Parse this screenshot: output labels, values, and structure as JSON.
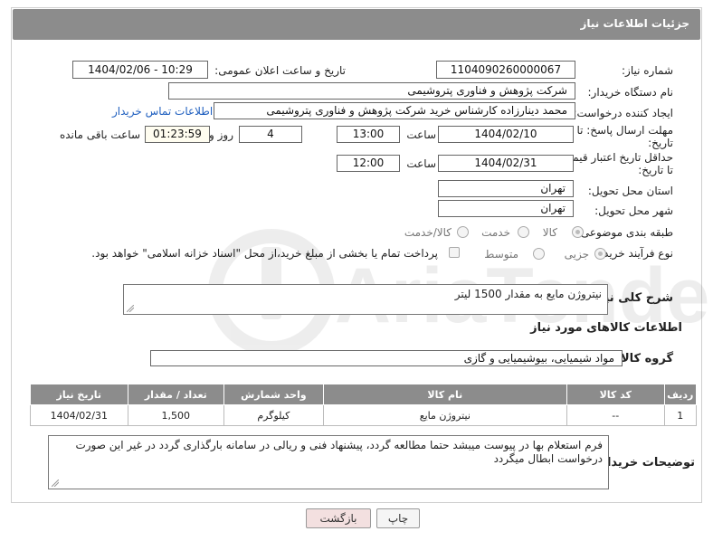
{
  "header": {
    "title": "جزئیات اطلاعات نیاز"
  },
  "fields": {
    "need_number": {
      "label": "شماره نیاز:",
      "value": "1104090260000067"
    },
    "announce_datetime": {
      "label": "تاریخ و ساعت اعلان عمومی:",
      "value": "1404/02/06 - 10:29"
    },
    "buyer_org": {
      "label": "نام دستگاه خریدار:",
      "value": "شرکت پژوهش و فناوری پتروشیمی"
    },
    "requester": {
      "label": "ایجاد کننده درخواست:",
      "value": "محمد دینارزاده کارشناس خرید شرکت پژوهش و فناوری پتروشیمی"
    },
    "contact_link": "اطلاعات تماس خریدار",
    "reply_deadline": {
      "label_line1": "مهلت ارسال پاسخ: تا",
      "label_line2": "تاریخ:",
      "date": "1404/02/10",
      "time_label": "ساعت",
      "time": "13:00",
      "days": "4",
      "days_label": "روز و",
      "remaining": "01:23:59",
      "remaining_label": "ساعت باقی مانده"
    },
    "price_validity": {
      "label_line1": "حداقل تاریخ اعتبار قیمت:",
      "label_line2": "تا تاریخ:",
      "date": "1404/02/31",
      "time_label": "ساعت",
      "time": "12:00"
    },
    "delivery_province": {
      "label": "استان محل تحویل:",
      "value": "تهران"
    },
    "delivery_city": {
      "label": "شهر محل تحویل:",
      "value": "تهران"
    },
    "category": {
      "label": "طبقه بندی موضوعی:",
      "options": [
        "کالا",
        "خدمت",
        "کالا/خدمت"
      ],
      "selected": "کالا"
    },
    "process_type": {
      "label": "نوع فرآیند خرید :",
      "options": [
        "جزیی",
        "متوسط"
      ],
      "selected": "جزیی",
      "treasury_note": "پرداخت تمام یا بخشی از مبلغ خرید،از محل \"اسناد خزانه اسلامی\" خواهد بود."
    }
  },
  "description": {
    "label": "شرح کلی نیاز:",
    "value": "نیتروژن مایع به مقدار 1500 لیتر"
  },
  "goods_section": {
    "title": "اطلاعات کالاهای مورد نیاز"
  },
  "goods_group": {
    "label": "گروه کالا:",
    "value": "مواد شیمیایی، بیوشیمیایی و  گازی"
  },
  "table": {
    "headers": [
      "ردیف",
      "کد کالا",
      "نام کالا",
      "واحد شمارش",
      "تعداد / مقدار",
      "تاریخ نیاز"
    ],
    "rows": [
      [
        "1",
        "--",
        "نیتروژن مایع",
        "کیلوگرم",
        "1,500",
        "1404/02/31"
      ]
    ]
  },
  "buyer_notes": {
    "label": "توضیحات خریدار:",
    "value": "فرم استعلام بها در پیوست میبشد حتما مطالعه گردد، پیشنهاد فنی و ریالی در سامانه بارگذاری گردد در غیر این صورت درخواست ابطال میگردد"
  },
  "buttons": {
    "print": "چاپ",
    "back": "بازگشت"
  },
  "watermark_text": "AriaTender.neT",
  "colors": {
    "header_bg": "#8c8c8c",
    "link": "#1f5fbf",
    "back_button_bg": "#f3e0e0"
  }
}
